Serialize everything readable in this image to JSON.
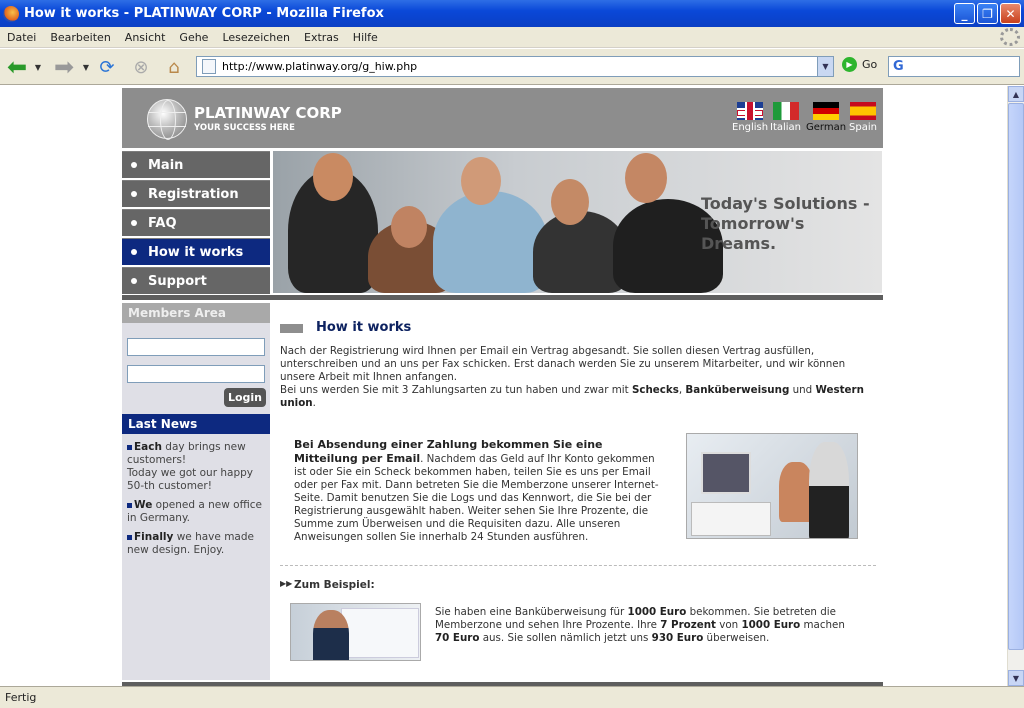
{
  "window": {
    "title": "How it works - PLATINWAY CORP - Mozilla Firefox"
  },
  "menu": [
    "Datei",
    "Bearbeiten",
    "Ansicht",
    "Gehe",
    "Lesezeichen",
    "Extras",
    "Hilfe"
  ],
  "toolbar": {
    "url": "http://www.platinway.org/g_hiw.php",
    "go_label": "Go"
  },
  "status": "Fertig",
  "site": {
    "name": "PLATINWAY CORP",
    "tagline": "YOUR SUCCESS HERE",
    "languages": [
      {
        "label": "English"
      },
      {
        "label": "Italian"
      },
      {
        "label": "German",
        "selected": true
      },
      {
        "label": "Spain"
      }
    ],
    "nav": [
      "Main",
      "Registration",
      "FAQ",
      "How it works",
      "Support"
    ],
    "nav_active": "How it works",
    "banner_line1": "Today's Solutions -",
    "banner_line2": "Tomorrow's Dreams."
  },
  "sidebar": {
    "members_title": "Members Area",
    "login_label": "Login",
    "news_title": "Last News",
    "news": [
      {
        "lead": "Each",
        "rest": " day brings new customers!",
        "extra": "Today we got our happy 50-th customer!"
      },
      {
        "lead": "We",
        "rest": " opened a new office in Germany.",
        "extra": ""
      },
      {
        "lead": "Finally",
        "rest": " we have made new design. Enjoy.",
        "extra": ""
      }
    ]
  },
  "main": {
    "title": "How it works",
    "intro_1": "Nach der Registrierung wird Ihnen per Email ein Vertrag abgesandt. Sie sollen diesen Vertrag ausfüllen, unterschreiben und an uns per Fax schicken. Erst danach werden Sie zu unserem Mitarbeiter, und wir können unsere Arbeit mit Ihnen anfangen.",
    "intro_2a": "Bei uns werden Sie mit 3 Zahlungsarten zu tun haben und zwar mit ",
    "intro_2b": "Schecks",
    "intro_2c": ", ",
    "intro_2d": "Banküberweisung",
    "intro_2e": " und ",
    "intro_2f": "Western union",
    "intro_2g": ".",
    "payment_bold": "Bei Absendung einer Zahlung bekommen Sie eine Mitteilung per Email",
    "payment_text": ". Nachdem das Geld auf Ihr Konto gekommen ist oder Sie ein Scheck bekommen haben, teilen Sie es uns per Email oder per Fax mit. Dann betreten Sie die Memberzone unserer Internet-Seite. Damit benutzen Sie die Logs und das Kennwort, die Sie bei der Registrierung ausgewählt haben. Weiter sehen Sie Ihre Prozente, die Summe zum Überweisen und die Requisiten dazu. Alle unseren Anweisungen sollen Sie innerhalb 24 Stunden ausführen.",
    "example_title": "Zum Beispiel:",
    "ex_1": "Sie haben eine Banküberweisung für ",
    "ex_2": "1000 Euro",
    "ex_3": " bekommen. Sie betreten die Memberzone und sehen Ihre Prozente. Ihre ",
    "ex_4": "7 Prozent",
    "ex_5": " von ",
    "ex_6": "1000 Euro",
    "ex_7": " machen ",
    "ex_8": "70 Euro",
    "ex_9": " aus. Sie sollen nämlich jetzt uns ",
    "ex_10": "930 Euro",
    "ex_11": " überweisen."
  }
}
